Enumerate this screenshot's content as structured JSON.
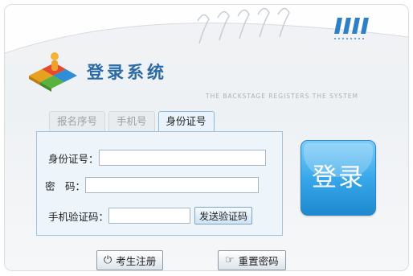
{
  "header": {
    "title": "登录系统",
    "subtitle": "THE BACKSTAGE REGISTERS THE SYSTEM"
  },
  "tabs": [
    {
      "label": "报名序号",
      "active": false
    },
    {
      "label": "手机号",
      "active": false
    },
    {
      "label": "身份证号",
      "active": true
    }
  ],
  "form": {
    "id_label": "身份证号：",
    "id_value": "",
    "password_label": "密　码：",
    "password_value": "",
    "sms_label": "手机验证码：",
    "sms_value": "",
    "sms_button": "发送验证码"
  },
  "login_button": "登录",
  "footer": {
    "register_button": "考生注册",
    "reset_button": "重置密码"
  },
  "colors": {
    "accent": "#2a6aa6",
    "login_blue": "#38a8ea",
    "form_border": "#9fc4df"
  },
  "icons": {
    "logo": "puzzle-person-logo",
    "register": "power-icon",
    "reset": "hand-point-icon"
  }
}
